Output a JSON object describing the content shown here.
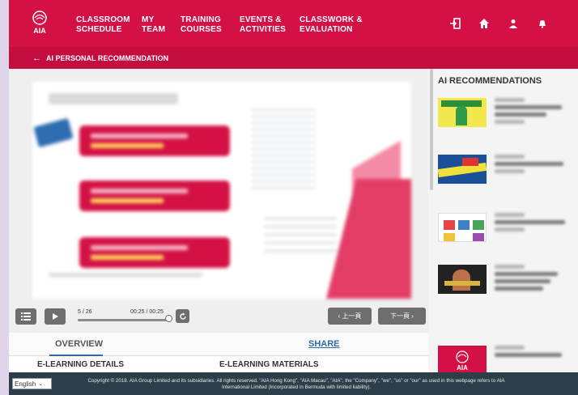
{
  "nav": {
    "items": [
      {
        "label": "CLASSROOM\nSCHEDULE"
      },
      {
        "label": "MY\nTEAM"
      },
      {
        "label": "TRAINING\nCOURSES"
      },
      {
        "label": "EVENTS &\nACTIVITIES"
      },
      {
        "label": "CLASSWORK &\nEVALUATION"
      }
    ],
    "icons": [
      "logout-icon",
      "home-icon",
      "user-icon",
      "bell-icon"
    ],
    "logo_text": "AIA"
  },
  "subheader": {
    "back_arrow": "←",
    "title": "AI PERSONAL RECOMMENDATION"
  },
  "player": {
    "page": "5 / 26",
    "time": "00:25 / 00:25",
    "progress": 1.0,
    "prev_label": "‹ 上一頁",
    "next_label": "下一頁 ›"
  },
  "tabs": {
    "overview": "OVERVIEW",
    "share": "SHARE"
  },
  "sections": {
    "details": "E-LEARNING DETAILS",
    "materials": "E-LEARNING MATERIALS"
  },
  "sidebar": {
    "title": "AI RECOMMENDATIONS",
    "thumb_logo": "AIA"
  },
  "footer": {
    "language": "English",
    "copyright": "Copyright © 2018. AIA Group Limited and its subsidiaries. All rights reserved. \"AIA Hong Kong\", \"AIA Macau\", \"AIA\", the \"Company\", \"we\", \"us\" or \"our\" as used in this webpage refers to AIA International Limited (Incorporated in Bermuda with limited liability)."
  },
  "colors": {
    "brand": "#d31145",
    "brand_dark": "#c20d3e",
    "footer": "#2c3e49",
    "link": "#2d6aa8"
  }
}
